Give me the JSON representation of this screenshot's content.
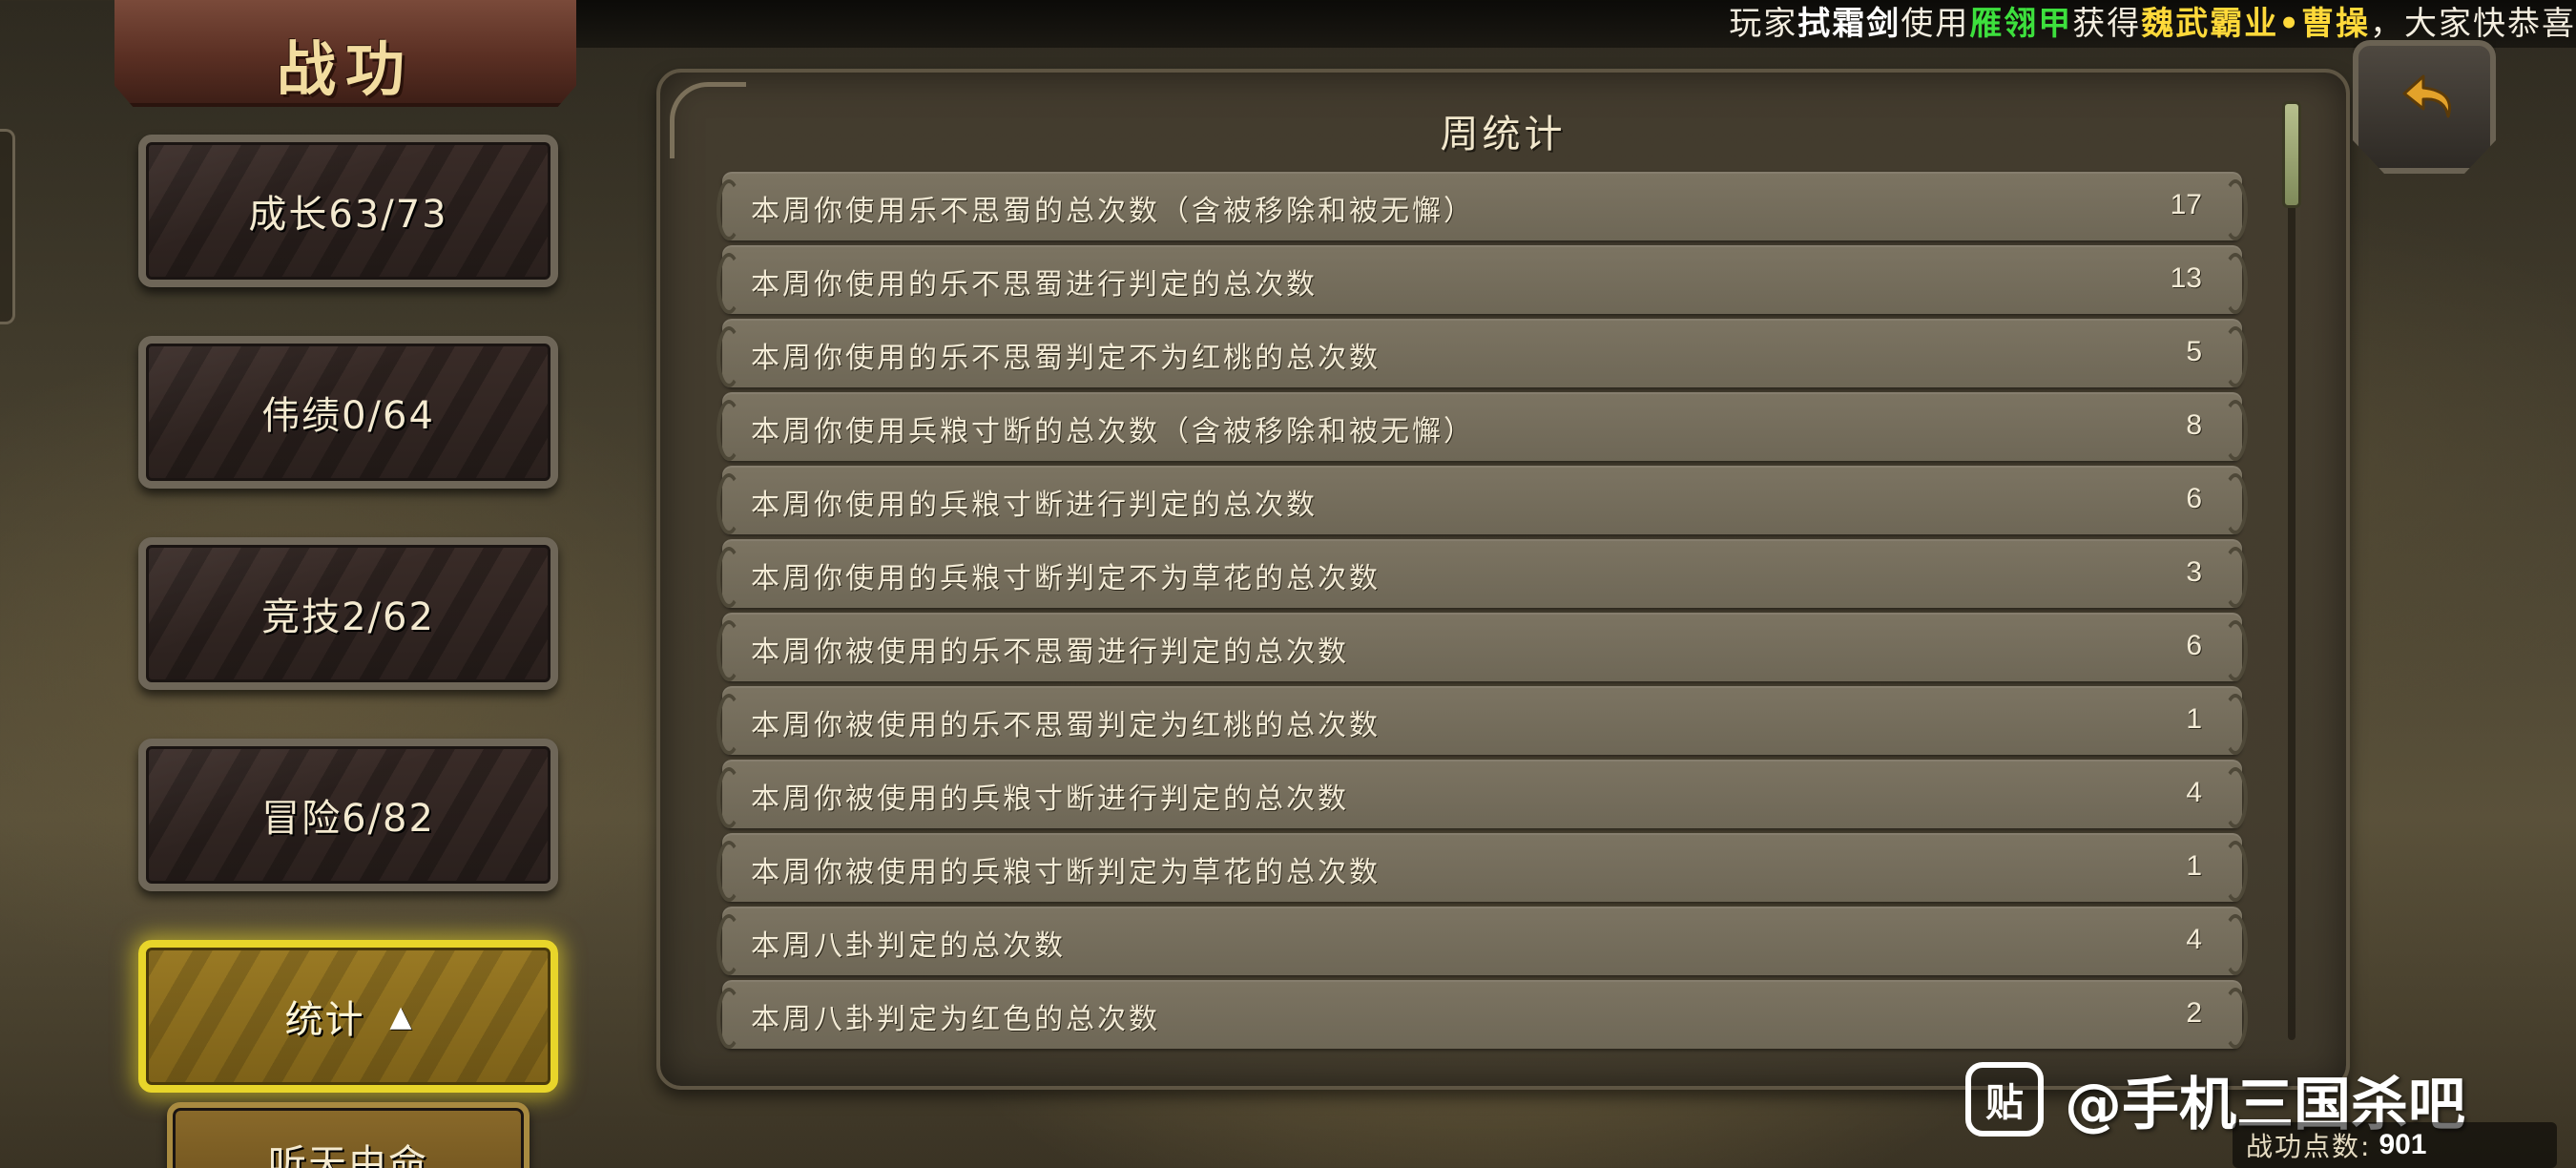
{
  "broadcast": {
    "prefix": "玩家",
    "player": "拭霜剑",
    "verb": "使用",
    "item": "雁翎甲",
    "get": "获得",
    "skin": "魏武霸业•曹操",
    "suffix": "，大家快恭喜"
  },
  "title": "战功",
  "sidebar": {
    "items": [
      {
        "label": "成长63/73"
      },
      {
        "label": "伟绩0/64"
      },
      {
        "label": "竞技2/62"
      },
      {
        "label": "冒险6/82"
      },
      {
        "label": "统计",
        "expanded_icon": "▲"
      },
      {
        "label": "听天由命"
      }
    ]
  },
  "panel": {
    "heading": "周统计",
    "rows": [
      {
        "label": "本周你使用乐不思蜀的总次数（含被移除和被无懈）",
        "value": "17"
      },
      {
        "label": "本周你使用的乐不思蜀进行判定的总次数",
        "value": "13"
      },
      {
        "label": "本周你使用的乐不思蜀判定不为红桃的总次数",
        "value": "5"
      },
      {
        "label": "本周你使用兵粮寸断的总次数（含被移除和被无懈）",
        "value": "8"
      },
      {
        "label": "本周你使用的兵粮寸断进行判定的总次数",
        "value": "6"
      },
      {
        "label": "本周你使用的兵粮寸断判定不为草花的总次数",
        "value": "3"
      },
      {
        "label": "本周你被使用的乐不思蜀进行判定的总次数",
        "value": "6"
      },
      {
        "label": "本周你被使用的乐不思蜀判定为红桃的总次数",
        "value": "1"
      },
      {
        "label": "本周你被使用的兵粮寸断进行判定的总次数",
        "value": "4"
      },
      {
        "label": "本周你被使用的兵粮寸断判定为草花的总次数",
        "value": "1"
      },
      {
        "label": "本周八卦判定的总次数",
        "value": "4"
      },
      {
        "label": "本周八卦判定为红色的总次数",
        "value": "2"
      }
    ]
  },
  "watermark": {
    "logo": "贴",
    "text": "@手机三国杀吧"
  },
  "points": {
    "label": "战功点数:",
    "value": "901"
  },
  "icons": {
    "back": "back-arrow-icon",
    "expand": "caret-up-icon",
    "logo": "tieba-logo-icon"
  },
  "colors": {
    "accent_active": "#e8d52a",
    "broadcast_item": "#3de03d",
    "broadcast_skin": "#ffd93a"
  }
}
